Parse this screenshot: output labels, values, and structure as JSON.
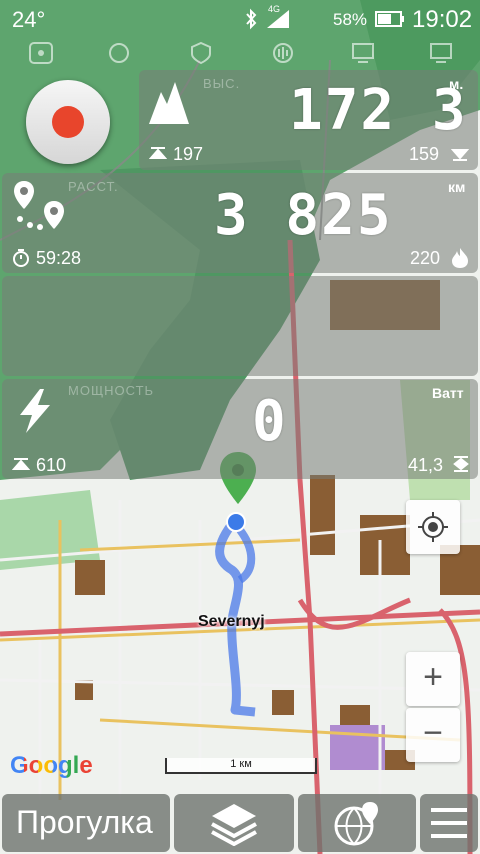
{
  "status_bar": {
    "temperature": "24°",
    "network": "4G",
    "battery": "58%",
    "time": "19:02",
    "icons": [
      "bluetooth-icon",
      "signal-icon",
      "battery-icon"
    ]
  },
  "toolbar_icons": [
    "map-marker-icon",
    "globe-icon",
    "shield-icon",
    "audio-icon",
    "monitor-icon"
  ],
  "record_button": {
    "state": "idle",
    "color": "#e8452c"
  },
  "panels": {
    "altitude": {
      "label": "ВЫС.",
      "value": "172 3",
      "unit": "м.",
      "min": "197",
      "max": "159"
    },
    "distance": {
      "label": "РАССТ.",
      "value": "3 825",
      "unit": "км",
      "duration": "59:28",
      "calories": "220"
    },
    "empty": {},
    "power": {
      "label": "МОЩНОСТЬ",
      "value": "0",
      "unit": "Ватт",
      "max": "610",
      "avg": "41,3"
    }
  },
  "map": {
    "place_label": "Severnyj",
    "scale_label": "1 км",
    "attribution": "Google",
    "colors": {
      "forest": "#5a9f6a",
      "route": "#4a78e8",
      "road": "#d9636d",
      "industrial": "#9a6a3a"
    }
  },
  "controls": {
    "locate": "crosshair-icon",
    "zoom_in": "+",
    "zoom_out": "−"
  },
  "bottom_bar": {
    "activity": "Прогулка",
    "layers": "layers-icon",
    "globe": "globe-pin-icon",
    "menu": "menu-icon"
  }
}
